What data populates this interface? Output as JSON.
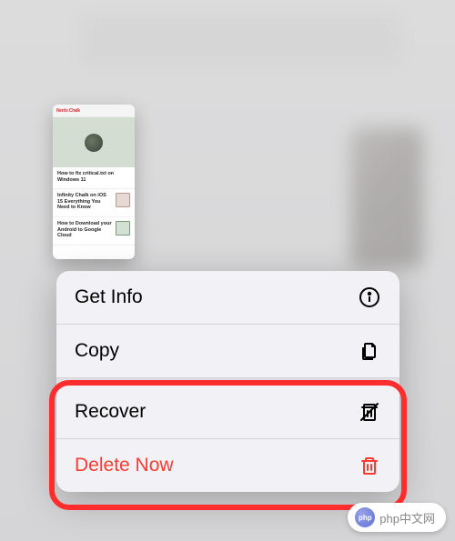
{
  "thumbnail": {
    "logo": "Nerds Chalk",
    "articles": [
      {
        "title": "How to fix critical.txt on Windows 11",
        "date": ""
      },
      {
        "title": "Infinity Chalk on iOS 15 Everything You Need to Know",
        "date": ""
      },
      {
        "title": "How to Download your Android to Google Cloud",
        "date": ""
      }
    ]
  },
  "menu": {
    "get_info": "Get Info",
    "copy": "Copy",
    "recover": "Recover",
    "delete_now": "Delete Now"
  },
  "watermark": {
    "logo_text": "php",
    "site": "php中文网"
  }
}
